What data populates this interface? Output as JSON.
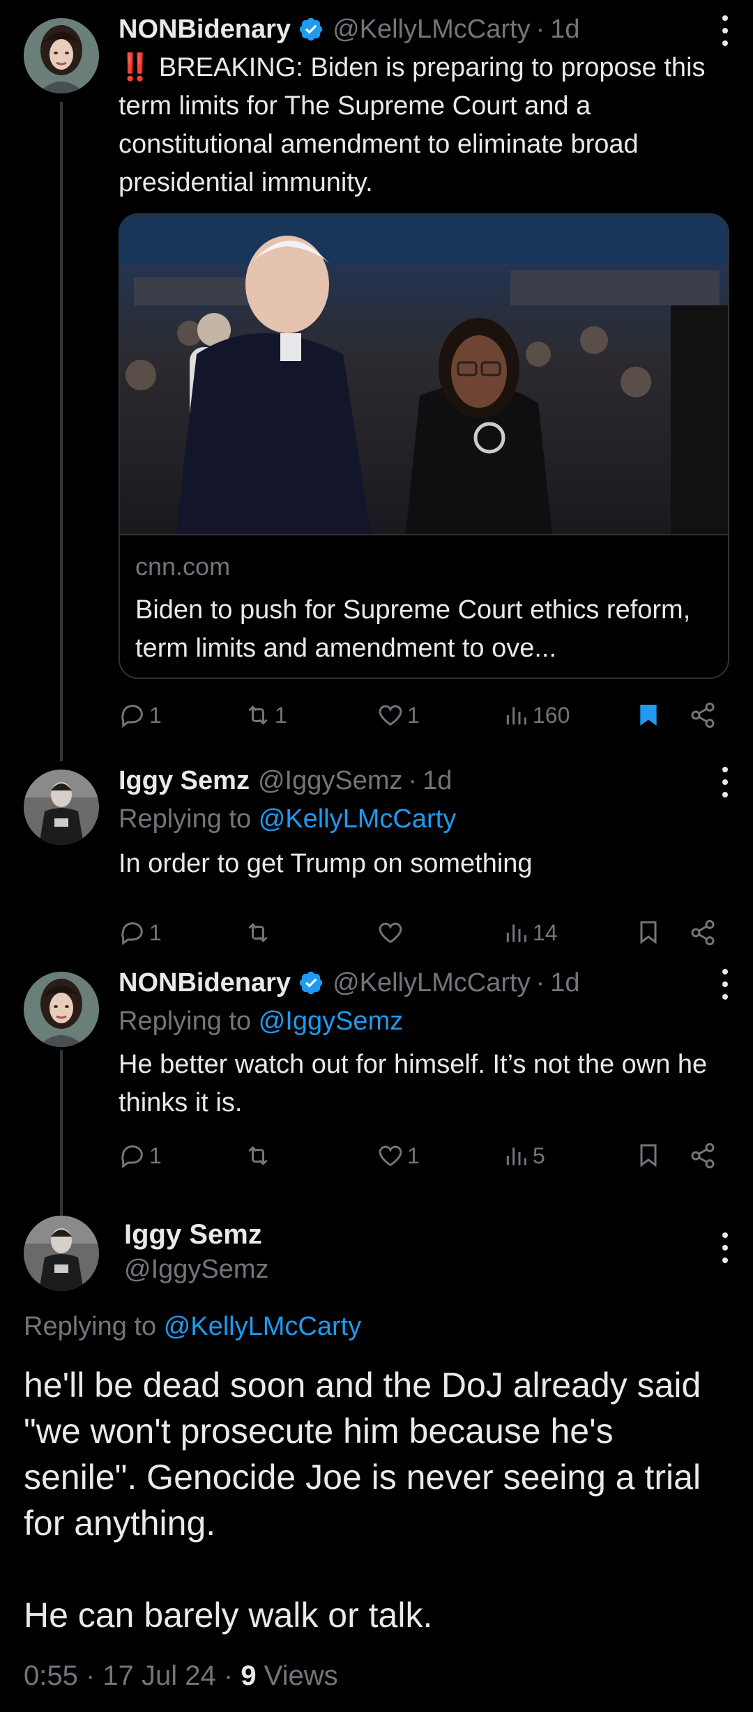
{
  "tweets": [
    {
      "name": "NONBidenary",
      "verified": true,
      "handle": "@KellyLMcCarty",
      "time": "1d",
      "text_prefix": "‼️",
      "text": "BREAKING: Biden is preparing to propose this term limits for The Supreme Court and a constitutional amendment to eliminate broad presidential immunity.",
      "card": {
        "domain": "cnn.com",
        "title": "Biden to push for Supreme Court ethics reform, term limits and amendment to ove..."
      },
      "replies": "1",
      "retweets": "1",
      "likes": "1",
      "views": "160",
      "bookmarked": true
    },
    {
      "name": "Iggy Semz",
      "handle": "@IggySemz",
      "time": "1d",
      "replying_label": "Replying to",
      "replying_to": "@KellyLMcCarty",
      "text": "In order to get Trump on something",
      "replies": "1",
      "retweets": "",
      "likes": "",
      "views": "14"
    },
    {
      "name": "NONBidenary",
      "verified": true,
      "handle": "@KellyLMcCarty",
      "time": "1d",
      "replying_label": "Replying to",
      "replying_to": "@IggySemz",
      "text": "He better watch out for himself. It’s not the own he thinks it is.",
      "replies": "1",
      "retweets": "",
      "likes": "1",
      "views": "5"
    }
  ],
  "main": {
    "name": "Iggy Semz",
    "handle": "@IggySemz",
    "replying_label": "Replying to",
    "replying_to": "@KellyLMcCarty",
    "text": "he'll be dead soon and the DoJ already said \"we won't prosecute him because he's senile\". Genocide Joe is never seeing a trial for anything.\n\nHe can barely walk or talk.",
    "time": "0:55",
    "date": "17 Jul 24",
    "views_count": "9",
    "views_label": "Views"
  },
  "colors": {
    "accent": "#1d9bf0",
    "muted": "#71767b",
    "text": "#e7e9ea",
    "background": "#000000"
  }
}
